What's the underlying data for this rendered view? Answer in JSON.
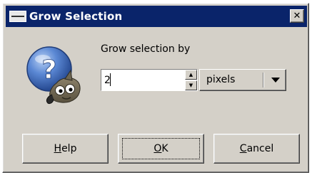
{
  "window": {
    "title": "Grow Selection",
    "close_glyph": "✕",
    "app_icon": "dialog-window-icon"
  },
  "dialog": {
    "icon": "gimp-question-mascot-icon",
    "question_glyph": "?",
    "label": "Grow selection by",
    "amount": {
      "value": "2"
    },
    "unit": {
      "selected": "pixels"
    }
  },
  "buttons": {
    "help": {
      "mnemonic": "H",
      "rest": "elp"
    },
    "ok": {
      "mnemonic": "O",
      "rest": "K"
    },
    "cancel": {
      "mnemonic": "C",
      "rest": "ancel"
    }
  },
  "colors": {
    "titlebar": "#0a246a",
    "face": "#d4d0c8",
    "mascot_blue": "#4a78c8"
  }
}
